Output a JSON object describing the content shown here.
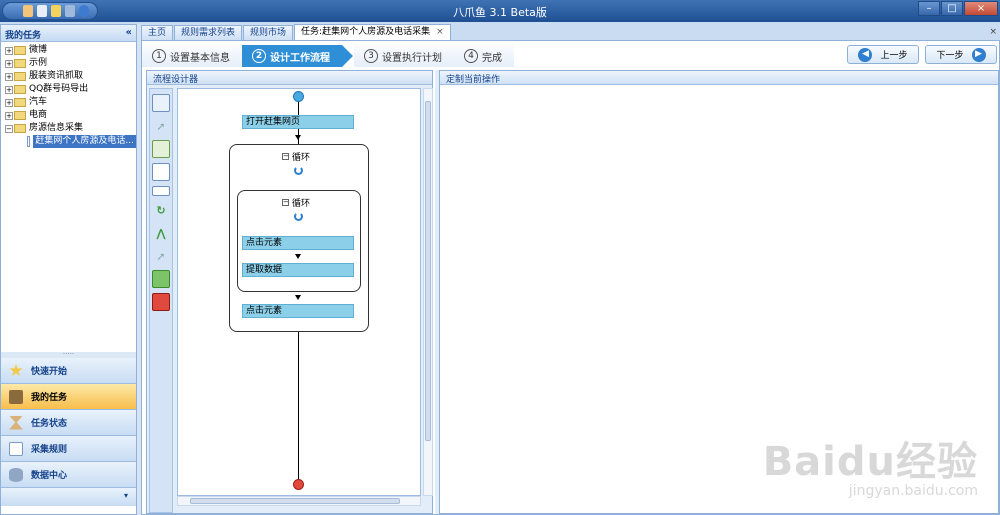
{
  "app": {
    "title": "八爪鱼 3.1 Beta版"
  },
  "left_panel": {
    "title": "我的任务",
    "collapse_glyph": "«",
    "tree": [
      {
        "label": "微博"
      },
      {
        "label": "示例"
      },
      {
        "label": "服装资讯抓取"
      },
      {
        "label": "QQ群号码导出"
      },
      {
        "label": "汽车"
      },
      {
        "label": "电商"
      },
      {
        "label": "房源信息采集",
        "expanded": true
      }
    ],
    "tree_child": "赶集网个人房源及电话...",
    "nav": [
      {
        "label": "快速开始",
        "icon": "star-icon"
      },
      {
        "label": "我的任务",
        "icon": "task-book-icon",
        "active": true
      },
      {
        "label": "任务状态",
        "icon": "hourglass-icon"
      },
      {
        "label": "采集规则",
        "icon": "document-icon"
      },
      {
        "label": "数据中心",
        "icon": "database-icon"
      }
    ],
    "nav_footer": "▾"
  },
  "tabs": [
    {
      "label": "主页"
    },
    {
      "label": "规则需求列表"
    },
    {
      "label": "规则市场"
    },
    {
      "label": "任务:赶集网个人房源及电话采集",
      "active": true,
      "close": "×"
    }
  ],
  "tab_close_all": "×",
  "steps": [
    {
      "num": "1",
      "label": "设置基本信息"
    },
    {
      "num": "2",
      "label": "设计工作流程",
      "active": true
    },
    {
      "num": "3",
      "label": "设置执行计划"
    },
    {
      "num": "4",
      "label": "完成"
    }
  ],
  "nav_buttons": {
    "prev": "上一步",
    "next": "下一步"
  },
  "designer": {
    "title": "流程设计器",
    "nodes": {
      "open_page": "打开赶集网页",
      "loop_outer": "循环",
      "loop_inner": "循环",
      "click_1": "点击元素",
      "extract": "提取数据",
      "click_2": "点击元素"
    },
    "tools": [
      "open-page-icon",
      "click-icon",
      "extract-data-icon",
      "input-text-icon",
      "select-option-icon",
      "loop-icon",
      "if-condition-icon",
      "mouse-hover-icon",
      "switch-icon",
      "end-loop-icon"
    ]
  },
  "custom_panel": {
    "title": "定制当前操作"
  },
  "watermark": {
    "text": "Baidu经验",
    "sub": "jingyan.baidu.com"
  },
  "colors": {
    "accent": "#2f8fd6",
    "node": "#8ccfe8",
    "title_bar": "#2a5c9e"
  }
}
